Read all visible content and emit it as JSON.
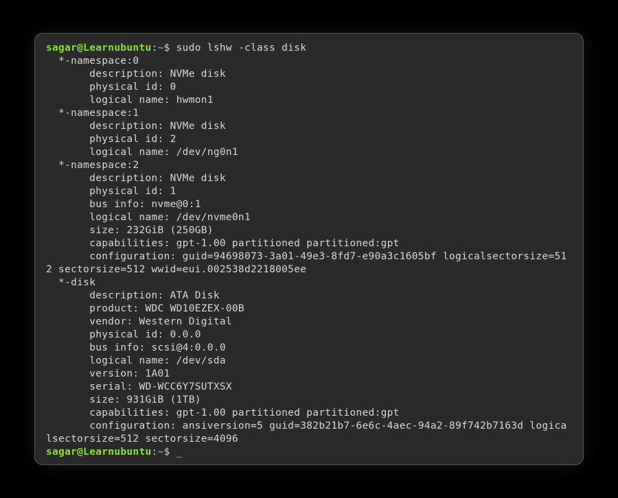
{
  "prompt": {
    "user_host": "sagar@Learnubuntu",
    "colon": ":",
    "path": "~",
    "dollar": "$ "
  },
  "command": "sudo lshw -class disk",
  "output_lines": [
    "  *-namespace:0",
    "       description: NVMe disk",
    "       physical id: 0",
    "       logical name: hwmon1",
    "  *-namespace:1",
    "       description: NVMe disk",
    "       physical id: 2",
    "       logical name: /dev/ng0n1",
    "  *-namespace:2",
    "       description: NVMe disk",
    "       physical id: 1",
    "       bus info: nvme@0:1",
    "       logical name: /dev/nvme0n1",
    "       size: 232GiB (250GB)",
    "       capabilities: gpt-1.00 partitioned partitioned:gpt",
    "       configuration: guid=94698073-3a01-49e3-8fd7-e90a3c1605bf logicalsectorsize=512 sectorsize=512 wwid=eui.002538d2218005ee",
    "  *-disk",
    "       description: ATA Disk",
    "       product: WDC WD10EZEX-00B",
    "       vendor: Western Digital",
    "       physical id: 0.0.0",
    "       bus info: scsi@4:0.0.0",
    "       logical name: /dev/sda",
    "       version: 1A01",
    "       serial: WD-WCC6Y7SUTXSX",
    "       size: 931GiB (1TB)",
    "       capabilities: gpt-1.00 partitioned partitioned:gpt",
    "       configuration: ansiversion=5 guid=382b21b7-6e6c-4aec-94a2-89f742b7163d logicalsectorsize=512 sectorsize=4096"
  ],
  "cursor": "_"
}
